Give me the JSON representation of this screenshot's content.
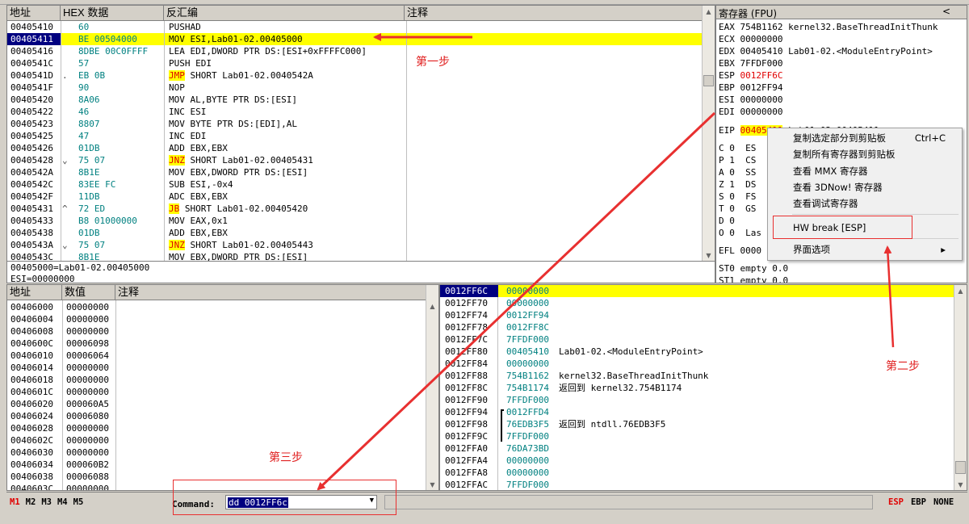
{
  "disasm": {
    "headers": [
      "地址",
      "HEX 数据",
      "反汇编",
      "注释"
    ],
    "rows": [
      {
        "addr": "00405410",
        "hex": "60",
        "asm": [
          [
            "PUSHAD",
            ""
          ]
        ],
        "cmt": ""
      },
      {
        "addr": "00405411",
        "hex": "BE 00504000",
        "asm": [
          [
            "MOV ESI,Lab01-02.00405000",
            ""
          ]
        ],
        "cmt": "",
        "selected": true
      },
      {
        "addr": "00405416",
        "hex": "8DBE 00C0FFFF",
        "asm": [
          [
            "LEA EDI,DWORD PTR DS:[ESI+0xFFFFC000]",
            ""
          ]
        ],
        "cmt": ""
      },
      {
        "addr": "0040541C",
        "hex": "57",
        "asm": [
          [
            "PUSH EDI",
            ""
          ]
        ],
        "cmt": ""
      },
      {
        "addr": "0040541D",
        "hex": "EB 0B",
        "mark": ".",
        "asm": [
          [
            "JMP",
            "kw"
          ],
          [
            " SHORT Lab01-02.0040542A",
            ""
          ]
        ],
        "cmt": ""
      },
      {
        "addr": "0040541F",
        "hex": "90",
        "asm": [
          [
            "NOP",
            ""
          ]
        ],
        "cmt": ""
      },
      {
        "addr": "00405420",
        "hex": "8A06",
        "asm": [
          [
            "MOV AL,BYTE PTR DS:[ESI]",
            ""
          ]
        ],
        "cmt": ""
      },
      {
        "addr": "00405422",
        "hex": "46",
        "asm": [
          [
            "INC ESI",
            ""
          ]
        ],
        "cmt": ""
      },
      {
        "addr": "00405423",
        "hex": "8807",
        "asm": [
          [
            "MOV BYTE PTR DS:[EDI],AL",
            ""
          ]
        ],
        "cmt": ""
      },
      {
        "addr": "00405425",
        "hex": "47",
        "asm": [
          [
            "INC EDI",
            ""
          ]
        ],
        "cmt": ""
      },
      {
        "addr": "00405426",
        "hex": "01DB",
        "asm": [
          [
            "ADD EBX,EBX",
            ""
          ]
        ],
        "cmt": ""
      },
      {
        "addr": "00405428",
        "hex": "75 07",
        "mark": "⌄",
        "asm": [
          [
            "JNZ",
            "kw"
          ],
          [
            " SHORT Lab01-02.00405431",
            ""
          ]
        ],
        "cmt": ""
      },
      {
        "addr": "0040542A",
        "hex": "8B1E",
        "asm": [
          [
            "MOV EBX,DWORD PTR DS:[ESI]",
            ""
          ]
        ],
        "cmt": ""
      },
      {
        "addr": "0040542C",
        "hex": "83EE FC",
        "asm": [
          [
            "SUB ESI,-0x4",
            ""
          ]
        ],
        "cmt": ""
      },
      {
        "addr": "0040542F",
        "hex": "11DB",
        "asm": [
          [
            "ADC EBX,EBX",
            ""
          ]
        ],
        "cmt": ""
      },
      {
        "addr": "00405431",
        "hex": "72 ED",
        "mark": "^",
        "asm": [
          [
            "JB",
            "kw"
          ],
          [
            " SHORT Lab01-02.00405420",
            ""
          ]
        ],
        "cmt": ""
      },
      {
        "addr": "00405433",
        "hex": "B8 01000000",
        "asm": [
          [
            "MOV EAX,0x1",
            ""
          ]
        ],
        "cmt": ""
      },
      {
        "addr": "00405438",
        "hex": "01DB",
        "asm": [
          [
            "ADD EBX,EBX",
            ""
          ]
        ],
        "cmt": ""
      },
      {
        "addr": "0040543A",
        "hex": "75 07",
        "mark": "⌄",
        "asm": [
          [
            "JNZ",
            "kw"
          ],
          [
            " SHORT Lab01-02.00405443",
            ""
          ]
        ],
        "cmt": ""
      },
      {
        "addr": "0040543C",
        "hex": "8B1E",
        "asm": [
          [
            "MOV EBX,DWORD PTR DS:[ESI]",
            ""
          ]
        ],
        "cmt": ""
      }
    ]
  },
  "info": {
    "line1": "00405000=Lab01-02.00405000",
    "line2": "ESI=00000000"
  },
  "registers": {
    "title": "寄存器 (FPU)",
    "collapse": "<",
    "rows": [
      {
        "name": "EAX",
        "val": "754B1162",
        "desc": "kernel32.BaseThreadInitThunk"
      },
      {
        "name": "ECX",
        "val": "00000000",
        "desc": ""
      },
      {
        "name": "EDX",
        "val": "00405410",
        "desc": "Lab01-02.<ModuleEntryPoint>"
      },
      {
        "name": "EBX",
        "val": "7FFDF000",
        "desc": ""
      },
      {
        "name": "ESP",
        "val": "0012FF6C",
        "desc": "",
        "red": true
      },
      {
        "name": "EBP",
        "val": "0012FF94",
        "desc": ""
      },
      {
        "name": "ESI",
        "val": "00000000",
        "desc": ""
      },
      {
        "name": "EDI",
        "val": "00000000",
        "desc": ""
      }
    ],
    "eip": {
      "name": "EIP",
      "val": "00405411",
      "desc": "Lab01-02.00405411"
    },
    "flags": [
      [
        "C",
        "0",
        "ES"
      ],
      [
        "P",
        "1",
        "CS"
      ],
      [
        "A",
        "0",
        "SS"
      ],
      [
        "Z",
        "1",
        "DS"
      ],
      [
        "S",
        "0",
        "FS"
      ],
      [
        "T",
        "0",
        "GS"
      ],
      [
        "D",
        "0",
        ""
      ],
      [
        "O",
        "0",
        "Las"
      ]
    ],
    "efl": {
      "name": "EFL",
      "val": "0000"
    },
    "fpu": [
      [
        "ST0",
        "empty",
        "0.0"
      ],
      [
        "ST1",
        "empty",
        "0.0"
      ]
    ]
  },
  "context_menu": {
    "items": [
      {
        "label": "复制选定部分到剪贴板",
        "shortcut": "Ctrl+C"
      },
      {
        "label": "复制所有寄存器到剪贴板",
        "shortcut": ""
      },
      {
        "label": "查看 MMX 寄存器",
        "shortcut": ""
      },
      {
        "label": "查看 3DNow! 寄存器",
        "shortcut": ""
      },
      {
        "label": "查看调试寄存器",
        "shortcut": ""
      },
      {
        "label": "HW break [ESP]",
        "shortcut": ""
      },
      {
        "label": "界面选项",
        "shortcut": "▸"
      }
    ]
  },
  "dump": {
    "headers": [
      "地址",
      "数值",
      "注释"
    ],
    "rows": [
      [
        "00406000",
        "00000000"
      ],
      [
        "00406004",
        "00000000"
      ],
      [
        "00406008",
        "00000000"
      ],
      [
        "0040600C",
        "00006098"
      ],
      [
        "00406010",
        "00006064"
      ],
      [
        "00406014",
        "00000000"
      ],
      [
        "00406018",
        "00000000"
      ],
      [
        "0040601C",
        "00000000"
      ],
      [
        "00406020",
        "000060A5"
      ],
      [
        "00406024",
        "00006080"
      ],
      [
        "00406028",
        "00000000"
      ],
      [
        "0040602C",
        "00000000"
      ],
      [
        "00406030",
        "00000000"
      ],
      [
        "00406034",
        "000060B2"
      ],
      [
        "00406038",
        "00006088"
      ],
      [
        "0040603C",
        "00000000"
      ]
    ]
  },
  "stack": {
    "rows": [
      {
        "addr": "0012FF6C",
        "val": "00000000",
        "cmt": "",
        "top": true
      },
      {
        "addr": "0012FF70",
        "val": "00000000",
        "cmt": ""
      },
      {
        "addr": "0012FF74",
        "val": "0012FF94",
        "cmt": ""
      },
      {
        "addr": "0012FF78",
        "val": "0012FF8C",
        "cmt": ""
      },
      {
        "addr": "0012FF7C",
        "val": "7FFDF000",
        "cmt": ""
      },
      {
        "addr": "0012FF80",
        "val": "00405410",
        "cmt": "Lab01-02.<ModuleEntryPoint>"
      },
      {
        "addr": "0012FF84",
        "val": "00000000",
        "cmt": ""
      },
      {
        "addr": "0012FF88",
        "val": "754B1162",
        "cmt": "kernel32.BaseThreadInitThunk"
      },
      {
        "addr": "0012FF8C",
        "val": "754B1174",
        "cmt": "返回到 kernel32.754B1174"
      },
      {
        "addr": "0012FF90",
        "val": "7FFDF000",
        "cmt": ""
      },
      {
        "addr": "0012FF94",
        "val": "0012FFD4",
        "cmt": "",
        "frame": true
      },
      {
        "addr": "0012FF98",
        "val": "76EDB3F5",
        "cmt": "返回到 ntdll.76EDB3F5"
      },
      {
        "addr": "0012FF9C",
        "val": "7FFDF000",
        "cmt": ""
      },
      {
        "addr": "0012FFA0",
        "val": "76DA73BD",
        "cmt": ""
      },
      {
        "addr": "0012FFA4",
        "val": "00000000",
        "cmt": ""
      },
      {
        "addr": "0012FFA8",
        "val": "00000000",
        "cmt": ""
      },
      {
        "addr": "0012FFAC",
        "val": "7FFDF000",
        "cmt": ""
      }
    ]
  },
  "statusbar": {
    "tabs": [
      "M1",
      "M2",
      "M3",
      "M4",
      "M5"
    ],
    "command_label": "Command:",
    "command_value": "dd 0012FF6c",
    "right": [
      "ESP",
      "EBP",
      "NONE"
    ]
  },
  "annotations": {
    "step1": "第一步",
    "step2": "第二步",
    "step3": "第三步"
  },
  "colors": {
    "selection": "#000080",
    "highlight": "#ffff00",
    "arrow": "#e83030"
  }
}
